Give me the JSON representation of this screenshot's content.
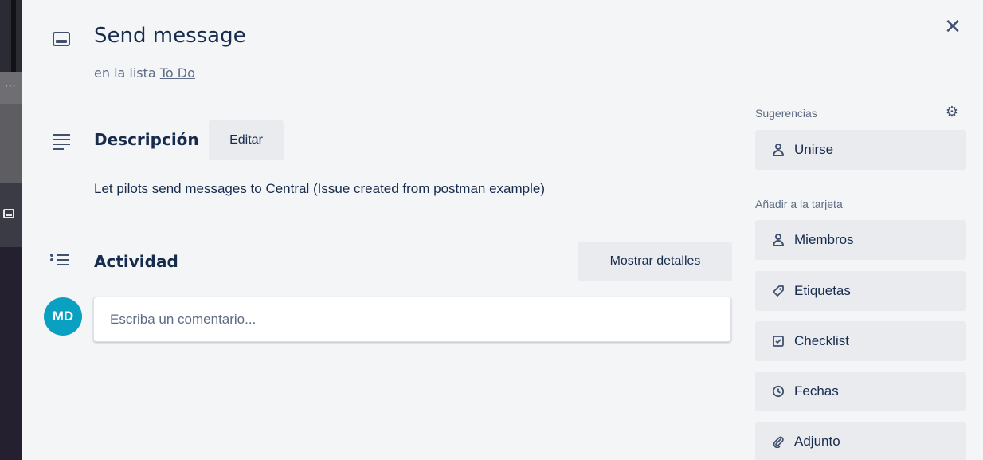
{
  "card": {
    "title": "Send message",
    "list_prefix": "en la lista",
    "list_name": "To Do"
  },
  "description": {
    "heading": "Descripción",
    "edit_label": "Editar",
    "text": "Let pilots send messages to Central (Issue created from postman example)"
  },
  "activity": {
    "heading": "Actividad",
    "details_label": "Mostrar detalles",
    "avatar_initials": "MD",
    "comment_placeholder": "Escriba un comentario..."
  },
  "sidebar": {
    "suggestions_label": "Sugerencias",
    "join_label": "Unirse",
    "add_to_card_label": "Añadir a la tarjeta",
    "items": [
      {
        "label": "Miembros",
        "icon": "person-icon"
      },
      {
        "label": "Etiquetas",
        "icon": "tag-icon"
      },
      {
        "label": "Checklist",
        "icon": "checklist-icon"
      },
      {
        "label": "Fechas",
        "icon": "clock-icon"
      },
      {
        "label": "Adjunto",
        "icon": "paperclip-icon"
      }
    ]
  },
  "colors": {
    "avatar": "#0aa0c2",
    "modal_bg": "#f4f5f7",
    "button_bg": "#e9ebee",
    "text": "#172b4d"
  }
}
